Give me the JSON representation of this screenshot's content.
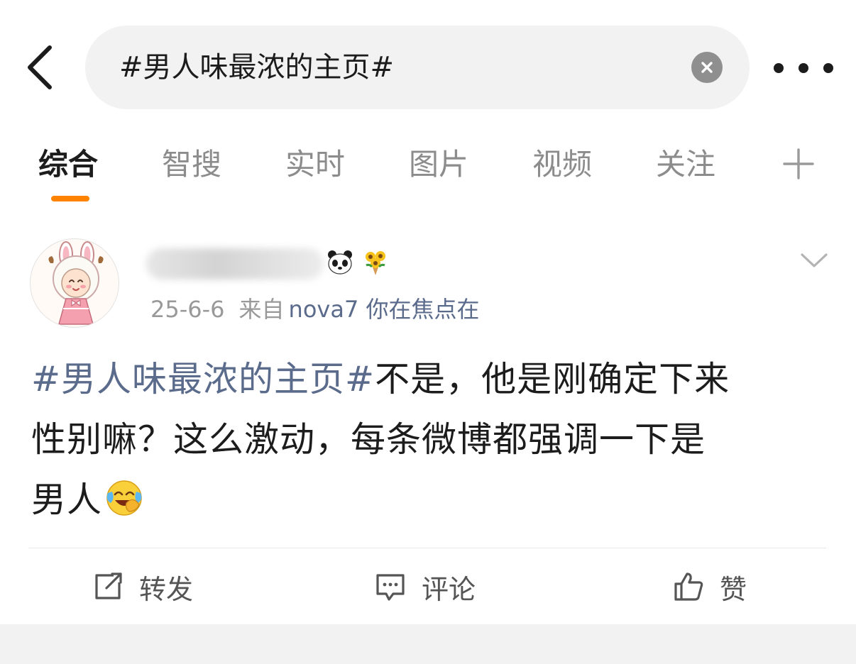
{
  "search": {
    "query": "#男人味最浓的主页#"
  },
  "tabs": [
    {
      "label": "综合",
      "active": true
    },
    {
      "label": "智搜"
    },
    {
      "label": "实时"
    },
    {
      "label": "图片"
    },
    {
      "label": "视频"
    },
    {
      "label": "关注"
    }
  ],
  "post": {
    "username_emojis": [
      "panda-icon",
      "bouquet-icon"
    ],
    "date": "25-6-6",
    "source_label": "来自",
    "source_name": "nova7 你在焦点在",
    "hashtag": "#男人味最浓的主页#",
    "text_line1": "不是，他是刚确定下来",
    "text_line2": "性别嘛？这么激动，每条微博都强调一下是",
    "text_line3": "男人",
    "trailing_emoji": "laughing-crying-icon"
  },
  "actions": {
    "repost": "转发",
    "comment": "评论",
    "like": "赞"
  },
  "colors": {
    "accent": "#ff8200",
    "link": "#5b6b8c",
    "search_bg": "#f2f2f2"
  }
}
